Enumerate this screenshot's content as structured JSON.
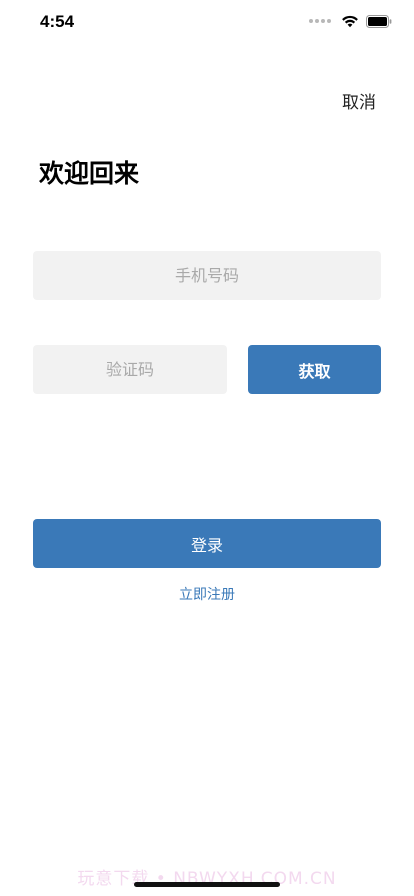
{
  "status_bar": {
    "time": "4:54",
    "icons": [
      "signal-dots-icon",
      "wifi-icon",
      "battery-icon"
    ]
  },
  "header": {
    "cancel_label": "取消"
  },
  "title": "欢迎回来",
  "form": {
    "phone": {
      "placeholder": "手机号码",
      "value": ""
    },
    "code": {
      "placeholder": "验证码",
      "value": ""
    },
    "get_code_label": "获取",
    "login_label": "登录",
    "register_label": "立即注册"
  },
  "watermark": "玩意下载 • NBWYXH.COM.CN",
  "colors": {
    "accent": "#3a79b8",
    "field_bg": "#f2f2f2",
    "placeholder": "#a9a9a9",
    "watermark": "#f3d9ef"
  }
}
